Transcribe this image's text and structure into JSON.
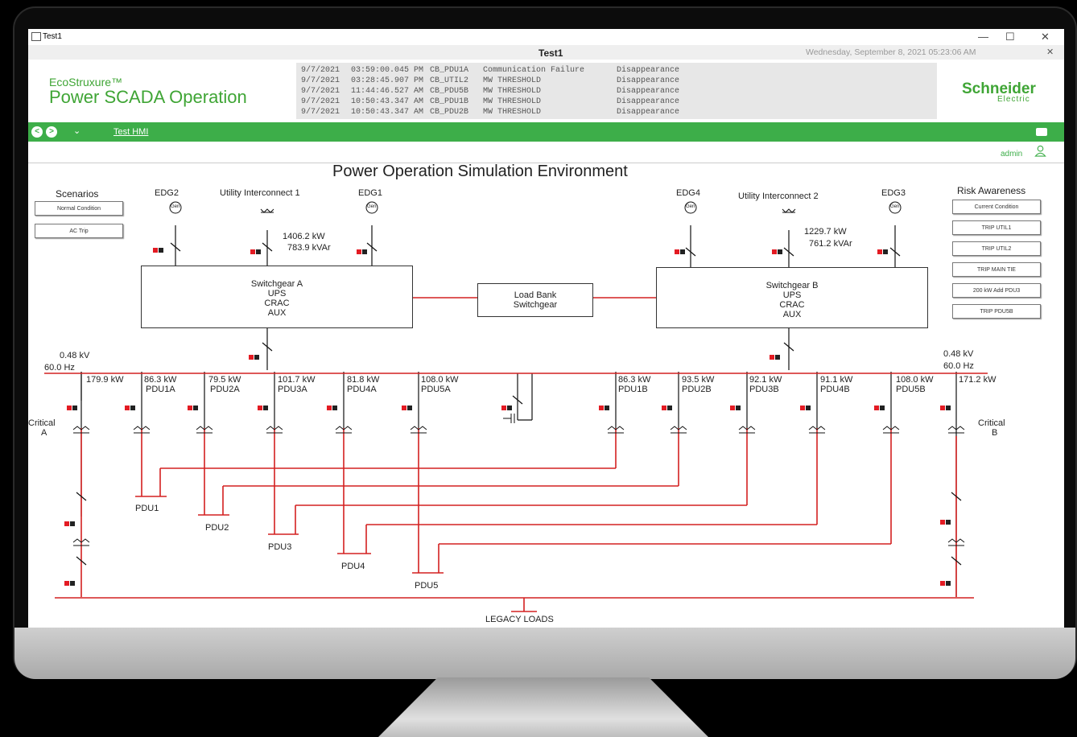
{
  "window": {
    "title": "Test1",
    "minimize": "—",
    "maximize": "☐",
    "close": "✕"
  },
  "tab": {
    "name": "Test1",
    "date": "Wednesday, September 8, 2021 05:23:06 AM",
    "close": "✕"
  },
  "brand": {
    "line1": "EcoStruxure™",
    "line2": "Power SCADA Operation",
    "vendor1": "Schneider",
    "vendor2": "Electric"
  },
  "alarms": [
    {
      "date": "9/7/2021",
      "time": "03:59:00.045 PM",
      "device": "CB_PDU1A",
      "event": "Communication Failure",
      "state": "Disappearance"
    },
    {
      "date": "9/7/2021",
      "time": "03:28:45.907 PM",
      "device": "CB_UTIL2",
      "event": "MW THRESHOLD",
      "state": "Disappearance"
    },
    {
      "date": "9/7/2021",
      "time": "11:44:46.527 AM",
      "device": "CB_PDU5B",
      "event": "MW THRESHOLD",
      "state": "Disappearance"
    },
    {
      "date": "9/7/2021",
      "time": "10:50:43.347 AM",
      "device": "CB_PDU1B",
      "event": "MW THRESHOLD",
      "state": "Disappearance"
    },
    {
      "date": "9/7/2021",
      "time": "10:50:43.347 AM",
      "device": "CB_PDU2B",
      "event": "MW THRESHOLD",
      "state": "Disappearance"
    }
  ],
  "nav": {
    "back": "<",
    "forward": ">",
    "menu": "⌄",
    "tab_label": "Test HMI"
  },
  "user": {
    "name": "admin"
  },
  "diagram": {
    "title": "Power Operation Simulation Environment",
    "scenarios": {
      "heading": "Scenarios",
      "buttons": [
        "Normal Condition",
        "AC Trip"
      ]
    },
    "risk": {
      "heading": "Risk Awareness",
      "buttons": [
        "Current Condition",
        "TRIP UTIL1",
        "TRIP UTIL2",
        "TRIP MAIN TIE",
        "200 kW Add PDU3",
        "TRIP PDU5B"
      ]
    },
    "sources_left": [
      "EDG2",
      "Utility Interconnect 1",
      "EDG1"
    ],
    "sources_right": [
      "EDG4",
      "Utility Interconnect 2",
      "EDG3"
    ],
    "gen_label": "Gen",
    "util1": {
      "kw": "1406.2 kW",
      "kvar": "783.9 kVAr"
    },
    "util2": {
      "kw": "1229.7 kW",
      "kvar": "761.2 kVAr"
    },
    "switchgear_a": [
      "Switchgear A",
      "UPS",
      "CRAC",
      "AUX"
    ],
    "switchgear_b": [
      "Switchgear B",
      "UPS",
      "CRAC",
      "AUX"
    ],
    "load_bank": [
      "Load Bank",
      "Switchgear"
    ],
    "bus_left": {
      "kv": "0.48 kV",
      "hz": "60.0 Hz"
    },
    "bus_right": {
      "kv": "0.48 kV",
      "hz": "60.0 Hz"
    },
    "feeders_a": [
      {
        "kw": "179.9 kW",
        "name": ""
      },
      {
        "kw": "86.3 kW",
        "name": "PDU1A"
      },
      {
        "kw": "79.5 kW",
        "name": "PDU2A"
      },
      {
        "kw": "101.7 kW",
        "name": "PDU3A"
      },
      {
        "kw": "81.8 kW",
        "name": "PDU4A"
      },
      {
        "kw": "108.0 kW",
        "name": "PDU5A"
      }
    ],
    "feeders_b": [
      {
        "kw": "86.3 kW",
        "name": "PDU1B"
      },
      {
        "kw": "93.5 kW",
        "name": "PDU2B"
      },
      {
        "kw": "92.1 kW",
        "name": "PDU3B"
      },
      {
        "kw": "91.1 kW",
        "name": "PDU4B"
      },
      {
        "kw": "108.0 kW",
        "name": "PDU5B"
      },
      {
        "kw": "171.2 kW",
        "name": ""
      }
    ],
    "critical_a": [
      "Critical",
      "A"
    ],
    "critical_b": [
      "Critical",
      "B"
    ],
    "pdus": [
      "PDU1",
      "PDU2",
      "PDU3",
      "PDU4",
      "PDU5"
    ],
    "legacy": "LEGACY LOADS"
  },
  "colors": {
    "accent": "#3dae49",
    "bus": "#d42020",
    "breaker_red": "#e31b23"
  }
}
